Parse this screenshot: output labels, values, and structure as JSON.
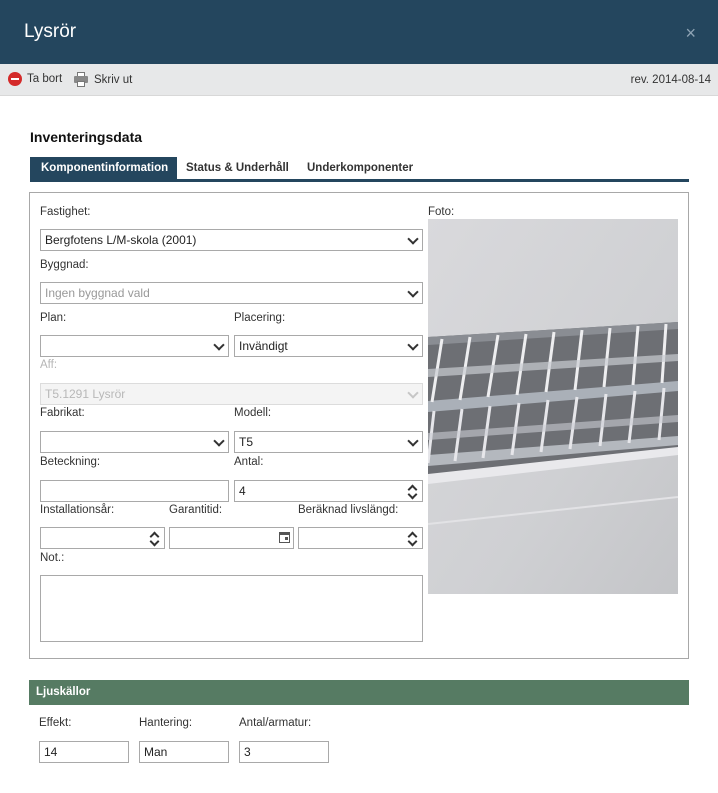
{
  "window": {
    "title": "Lysrör",
    "close_glyph": "×"
  },
  "toolbar": {
    "delete_label": "Ta bort",
    "print_label": "Skriv ut",
    "revision": "rev. 2014-08-14"
  },
  "section_title": "Inventeringsdata",
  "tabs": [
    {
      "label": "Komponentinformation",
      "active": true
    },
    {
      "label": "Status & Underhåll",
      "active": false
    },
    {
      "label": "Underkomponenter",
      "active": false
    }
  ],
  "form": {
    "fastighet": {
      "label": "Fastighet:",
      "value": "Bergfotens L/M-skola (2001)"
    },
    "byggnad": {
      "label": "Byggnad:",
      "placeholder": "Ingen byggnad vald"
    },
    "plan": {
      "label": "Plan:",
      "value": ""
    },
    "placering": {
      "label": "Placering:",
      "value": "Invändigt"
    },
    "aff": {
      "label": "Aff:",
      "value": "T5.1291 Lysrör"
    },
    "fabrikat": {
      "label": "Fabrikat:",
      "value": ""
    },
    "modell": {
      "label": "Modell:",
      "value": "T5"
    },
    "beteckning": {
      "label": "Beteckning:",
      "value": ""
    },
    "antal": {
      "label": "Antal:",
      "value": "4"
    },
    "installationsar": {
      "label": "Installationsår:",
      "value": ""
    },
    "garantitid": {
      "label": "Garantitid:",
      "value": ""
    },
    "livslangd": {
      "label": "Beräknad livslängd:",
      "value": ""
    },
    "not": {
      "label": "Not.:",
      "value": ""
    },
    "foto": {
      "label": "Foto:"
    }
  },
  "ljuskallor": {
    "header": "Ljuskällor",
    "effekt": {
      "label": "Effekt:",
      "value": "14"
    },
    "hantering": {
      "label": "Hantering:",
      "value": "Man"
    },
    "antal_armatur": {
      "label": "Antal/armatur:",
      "value": "3"
    }
  },
  "colors": {
    "header": "#24465e",
    "toolbar": "#e7e8e9",
    "tab_active": "#24465e",
    "section_bar": "#567b63",
    "delete_icon": "#d42a2a"
  },
  "icons": {
    "delete": "minus-circle-icon",
    "print": "printer-icon",
    "close": "close-icon",
    "dropdown": "chevron-down-icon",
    "spinner": "spinner-icon",
    "calendar": "calendar-icon"
  }
}
